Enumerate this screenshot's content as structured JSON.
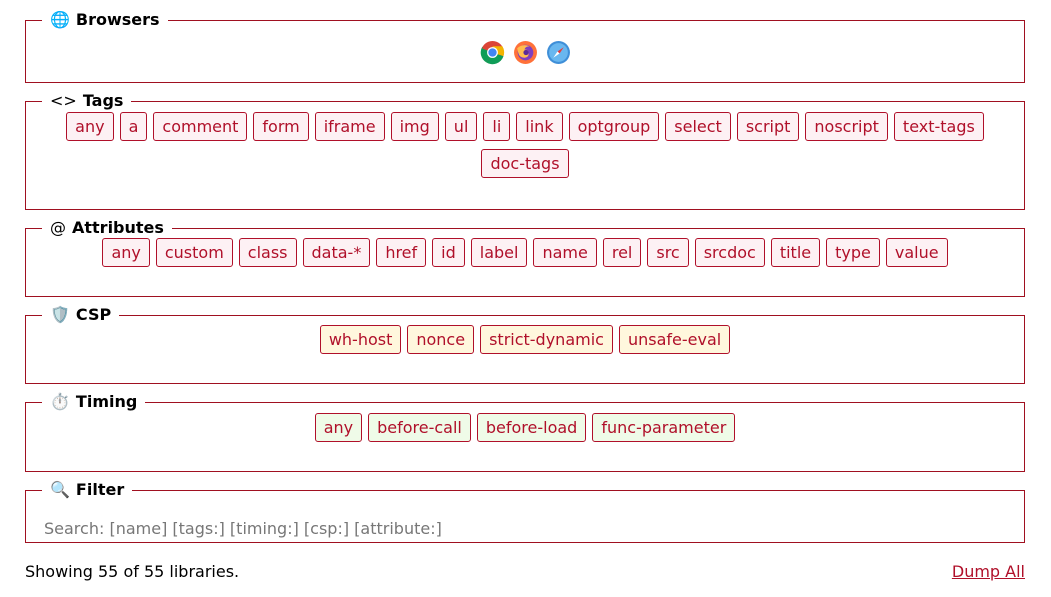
{
  "sections": {
    "browsers": {
      "icon": "🌐",
      "title": "Browsers",
      "items": [
        "chrome-icon",
        "firefox-icon",
        "safari-icon"
      ]
    },
    "tags": {
      "icon": "<>",
      "title": "Tags",
      "items": [
        "any",
        "a",
        "comment",
        "form",
        "iframe",
        "img",
        "ul",
        "li",
        "link",
        "optgroup",
        "select",
        "script",
        "noscript",
        "text-tags",
        "doc-tags"
      ]
    },
    "attributes": {
      "icon": "@",
      "title": "Attributes",
      "items": [
        "any",
        "custom",
        "class",
        "data-*",
        "href",
        "id",
        "label",
        "name",
        "rel",
        "src",
        "srcdoc",
        "title",
        "type",
        "value"
      ]
    },
    "csp": {
      "icon": "🛡️",
      "title": "CSP",
      "items": [
        "wh-host",
        "nonce",
        "strict-dynamic",
        "unsafe-eval"
      ]
    },
    "timing": {
      "icon": "⏱️",
      "title": "Timing",
      "items": [
        "any",
        "before-call",
        "before-load",
        "func-parameter"
      ]
    },
    "filter": {
      "icon": "🔍",
      "title": "Filter",
      "placeholder": "Search: [name] [tags:] [timing:] [csp:] [attribute:]",
      "value": ""
    }
  },
  "status": "Showing 55 of 55 libraries.",
  "dump_label": "Dump All",
  "colors": {
    "border": "#a01020",
    "tag_text": "#b0102a",
    "tags_bg": "#fdf1f4",
    "csp_bg": "#fff7dd",
    "timing_bg": "#effbe8"
  }
}
